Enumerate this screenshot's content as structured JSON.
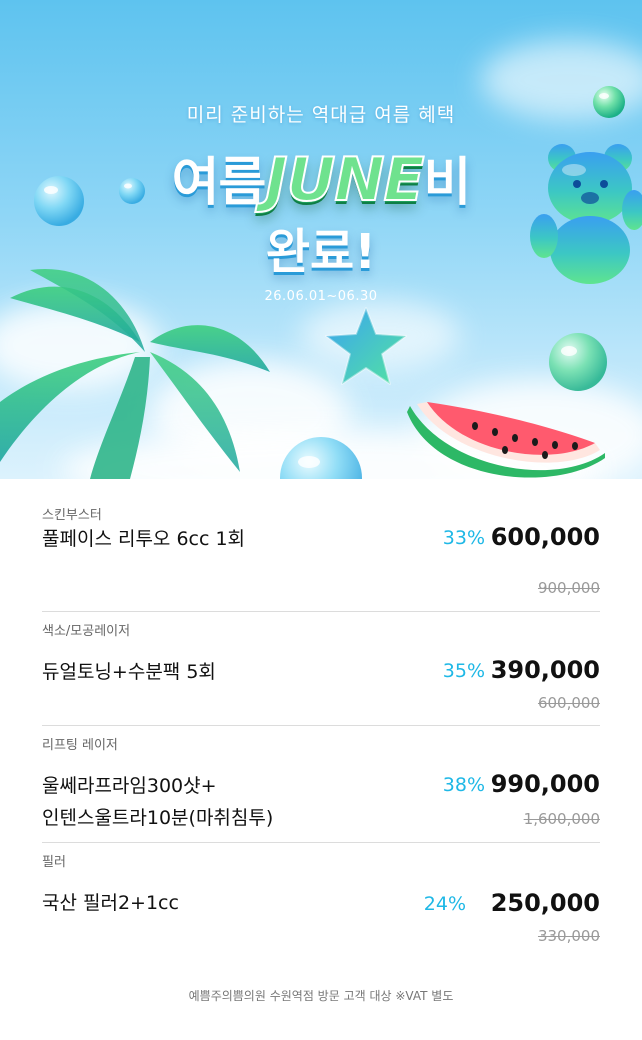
{
  "hero": {
    "subtitle": "미리 준비하는 역대급 여름 혜택",
    "title_left": "여름",
    "title_june": "JUNE",
    "title_right": "비",
    "title_line2": "완료!",
    "period": "26.06.01~06.30"
  },
  "items": [
    {
      "category": "스킨부스터",
      "name_lines": [
        "풀페이스 리투오 6cc 1회"
      ],
      "discount": "33%",
      "price": "600,000",
      "original": "900,000"
    },
    {
      "category": "색소/모공레이저",
      "name_lines": [
        "듀얼토닝+수분팩 5회"
      ],
      "discount": "35%",
      "price": "390,000",
      "original": "600,000"
    },
    {
      "category": "리프팅 레이저",
      "name_lines": [
        "울쎄라프라임300샷+",
        "인텐스울트라10분(마취침투)"
      ],
      "discount": "38%",
      "price": "990,000",
      "original": "1,600,000"
    },
    {
      "category": "필러",
      "name_lines": [
        "국산 필러2+1cc"
      ],
      "discount": "24%",
      "price": "250,000",
      "original": "330,000"
    }
  ],
  "footer": "예쁨주의쁨의원 수원역점 방문 고객 대상 ※VAT 별도",
  "colors": {
    "discount": "#1fb8e6",
    "sky": "#6cc8f0",
    "accent_green": "#6fe28e"
  }
}
